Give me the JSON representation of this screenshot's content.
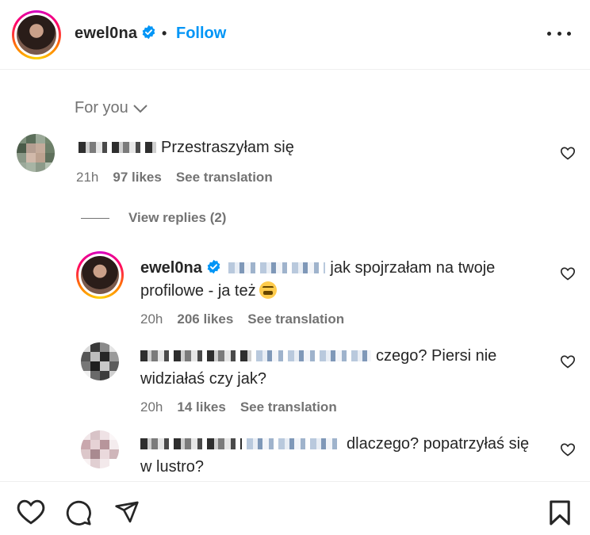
{
  "header": {
    "username": "ewel0na",
    "separator": "•",
    "follow_label": "Follow",
    "verified_color": "#0095f6"
  },
  "filter": {
    "label": "For you",
    "icon": "chevron-down-icon"
  },
  "comments": [
    {
      "text": "Przestraszyłam się",
      "time": "21h",
      "likes": "97 likes",
      "translate": "See translation"
    }
  ],
  "view_replies": "View replies (2)",
  "replies": [
    {
      "username": "ewel0na",
      "text_line1": "jak spojrzałam na twoje",
      "text_line2": "profilowe - ja też",
      "emoji": "tired-face-emoji",
      "time": "20h",
      "likes": "206 likes",
      "translate": "See translation"
    },
    {
      "text_line1": "czego? Piersi nie",
      "text_line2": "widziałaś czy jak?",
      "time": "20h",
      "likes": "14 likes",
      "translate": "See translation"
    },
    {
      "text_line1": "dlaczego? popatrzyłaś się",
      "text_line2": "w lustro?"
    }
  ],
  "footer": {
    "icons": [
      "heart-icon",
      "comment-icon",
      "share-icon",
      "bookmark-icon"
    ]
  },
  "colors": {
    "accent": "#0095f6",
    "secondary_text": "#737373",
    "primary_text": "#262626"
  }
}
